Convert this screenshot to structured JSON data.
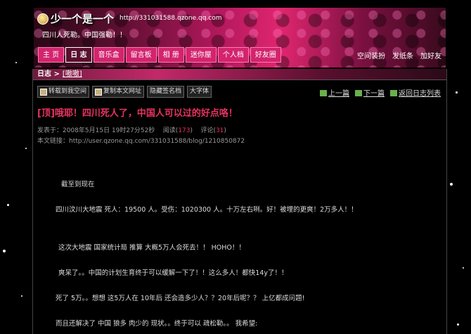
{
  "header": {
    "title": "少一个是一个",
    "url": "http://331031588.qzone.qq.com",
    "motto": "四川人死勒。中国强勒！！",
    "tabs": [
      "主 页",
      "日 志",
      "音乐盒",
      "留言板",
      "相 册",
      "迷你屋",
      "个人档",
      "好友圈"
    ],
    "right_links": [
      "空间装扮",
      "发纸条",
      "加好友"
    ]
  },
  "crumb": {
    "section": "日志 >",
    "current": "[嗷嗷]"
  },
  "toolbar": [
    "转载到我空间",
    "复制本文网址",
    "隐藏签名档",
    "大字体"
  ],
  "rnav": [
    "上一篇",
    "下一篇",
    "返回日志列表"
  ],
  "post": {
    "title": "[顶]哦耶！四川死人了，中国人可以过的好点咯！",
    "published_label": "发表于：2008年5月15日 19时27分52秒",
    "read_label": "阅读(",
    "read_count": "173",
    "comment_label": "评论(",
    "comment_count": "31",
    "close": ")",
    "link_text": "本文链接：http://user.qzone.qq.com/331031588/blog/1210850872",
    "paragraphs": [
      "截至到现在",
      "四川汶川大地震 死人：19500 人。受伤：1020300 人。十万左右咧。好！被埋的更爽！2万多人！！",
      "这次大地震 国家统计局 推算 大概5万人会死去！！  HOHO！！",
      "爽呆了。。中国的计划生育终于可以缓解一下了！！这么多人！都快14y了！！",
      "死了  5万。。想想  这5万人在  10年后  还会造多少人？？20年后呢？？  上亿都成问题!",
      "而且还解决了  中国  狼多  肉少的  现状。。终于可以  疏松勒。。  我希望:"
    ]
  },
  "colors": {
    "accent": "#e8335f",
    "tab": "#d3246e",
    "header_pink": "#e0266f"
  }
}
